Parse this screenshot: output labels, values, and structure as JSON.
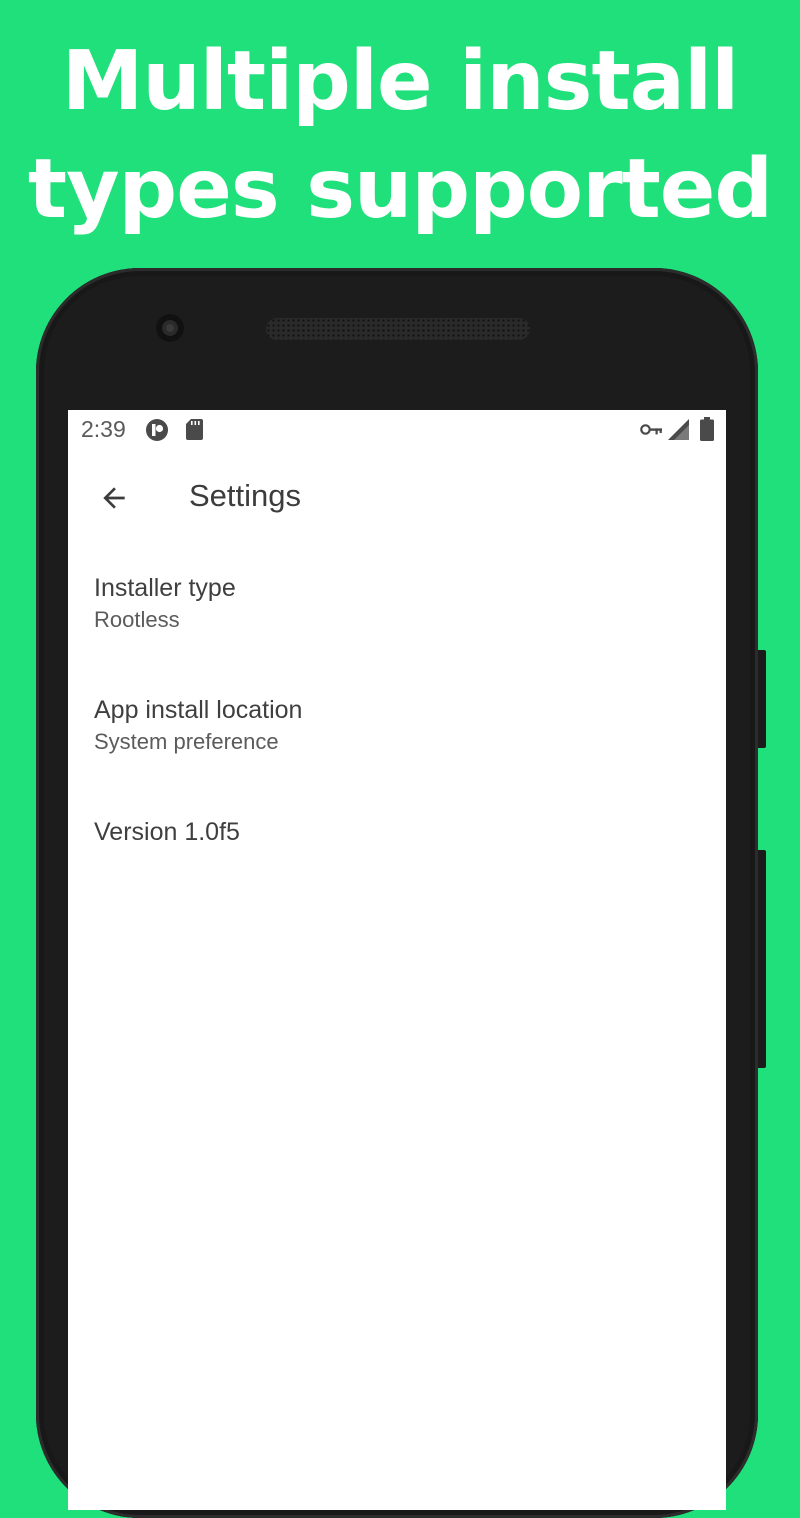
{
  "headline": {
    "line1": "Multiple install",
    "line2": "types supported"
  },
  "status_bar": {
    "time": "2:39",
    "left_icons": [
      "app-notification-icon",
      "sd-card-icon"
    ],
    "right_icons": [
      "vpn-key-icon",
      "cell-signal-icon",
      "battery-icon"
    ]
  },
  "toolbar": {
    "title": "Settings",
    "back_icon": "arrow-back-icon"
  },
  "preferences": [
    {
      "title": "Installer type",
      "summary": "Rootless"
    },
    {
      "title": "App install location",
      "summary": "System preference"
    },
    {
      "title": "Version 1.0f5",
      "summary": ""
    }
  ],
  "colors": {
    "background": "#1fe07a",
    "headline_text": "#ffffff",
    "screen": "#ffffff",
    "phone_body": "#1c1c1c"
  }
}
